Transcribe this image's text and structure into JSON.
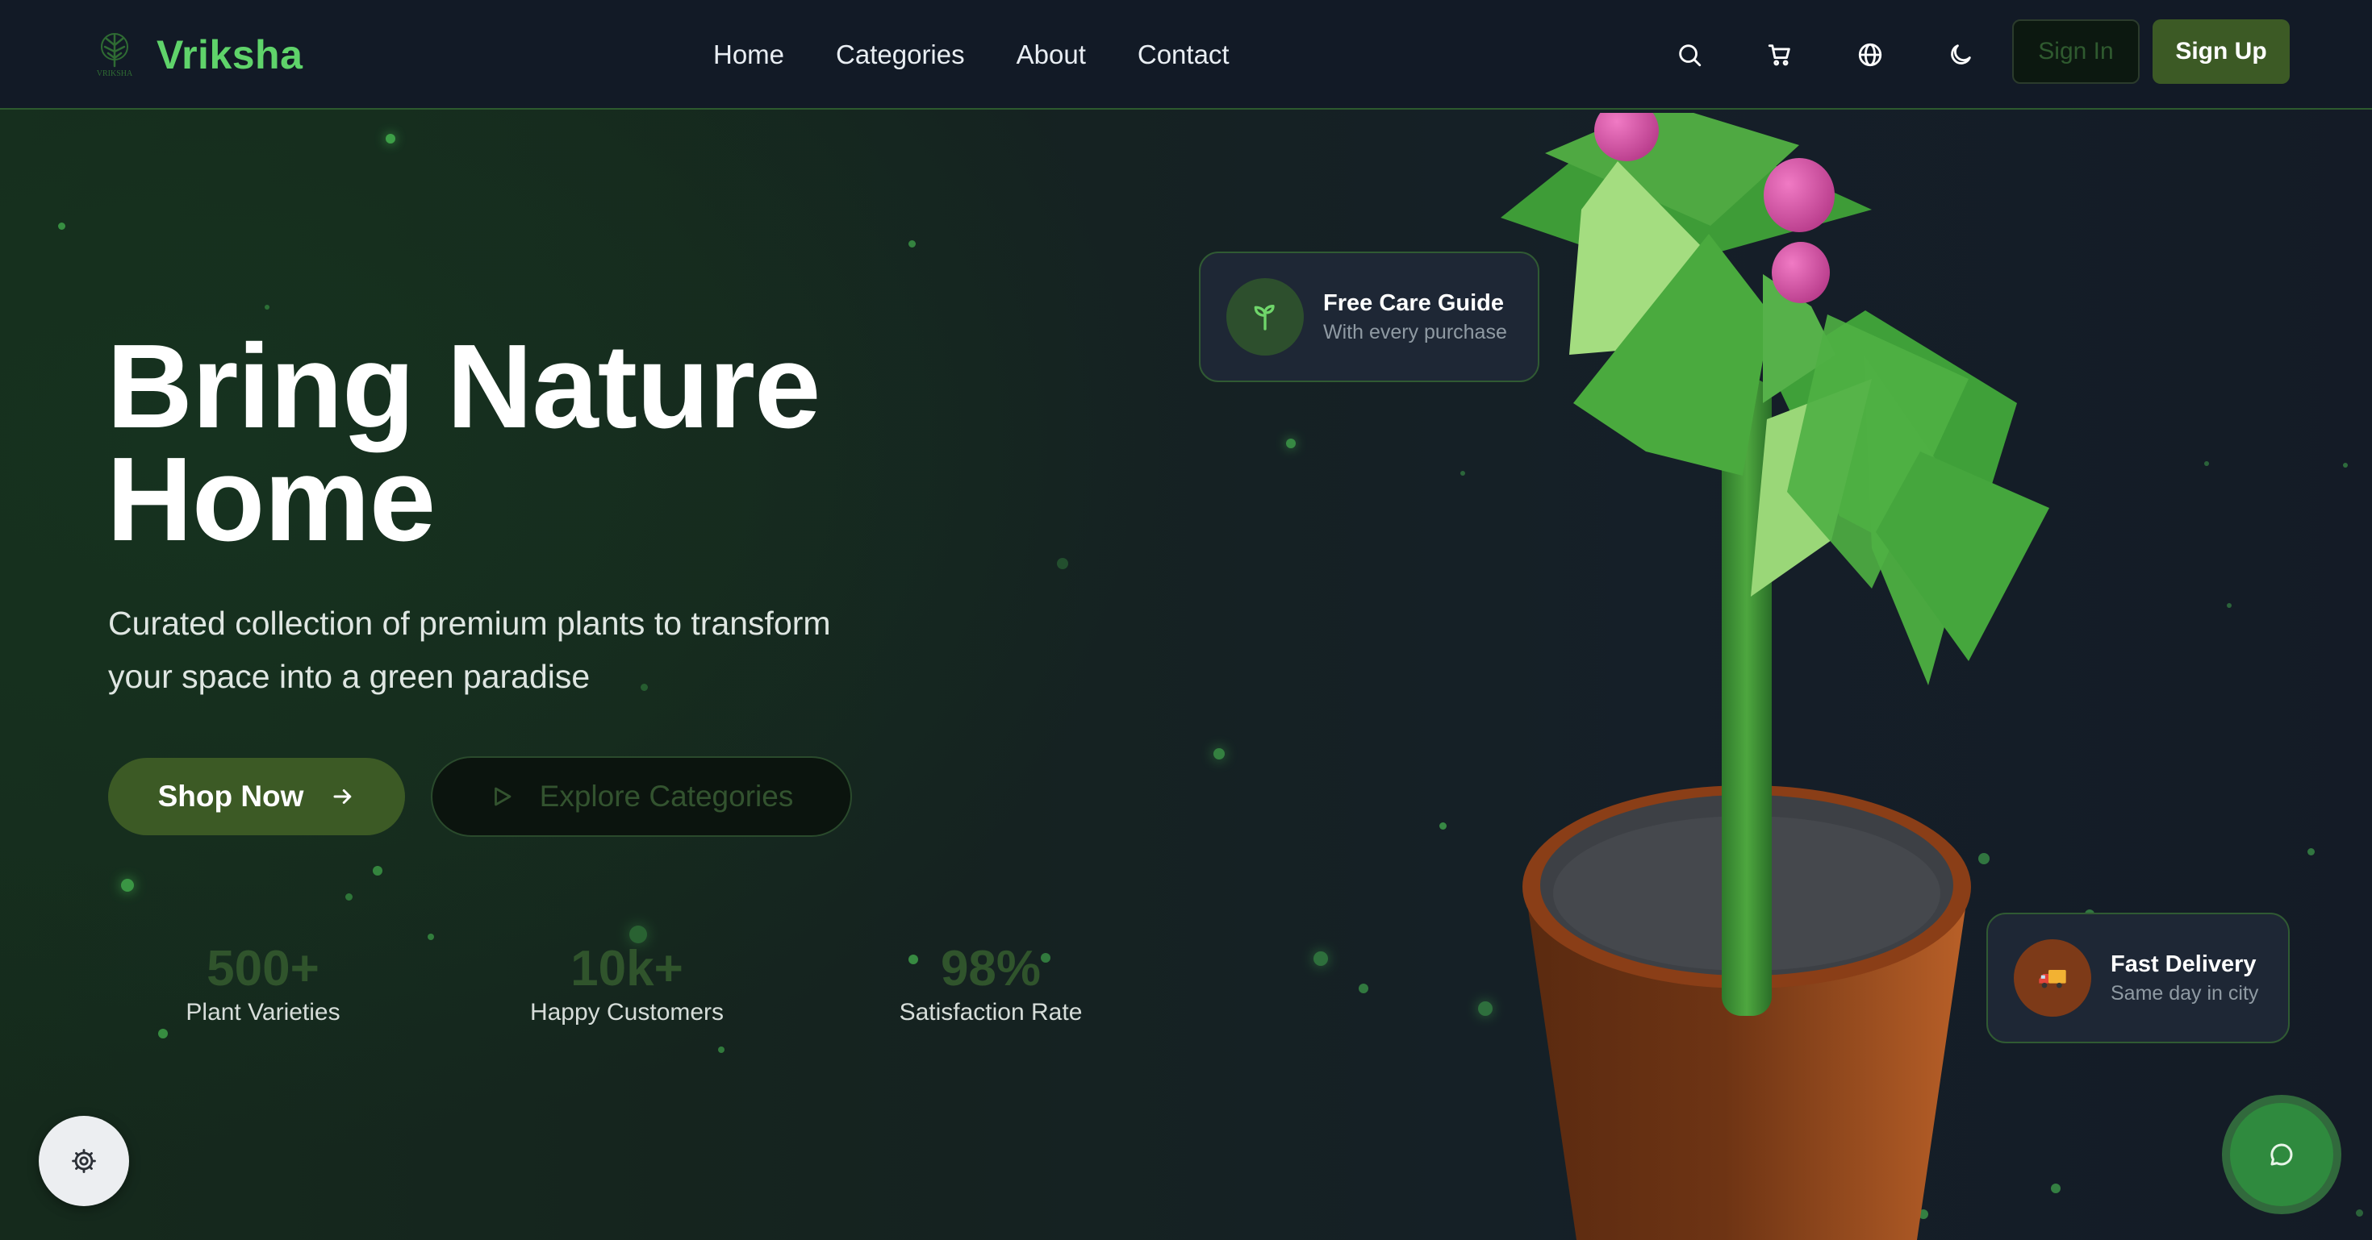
{
  "brand": {
    "name": "Vriksha",
    "logo_text": "VRIKSHA"
  },
  "nav": {
    "links": [
      "Home",
      "Categories",
      "About",
      "Contact"
    ],
    "tools": [
      "search-icon",
      "cart-icon",
      "globe-icon",
      "moon-icon"
    ],
    "sign_in": "Sign In",
    "sign_up": "Sign Up"
  },
  "hero": {
    "title_line1": "Bring Nature",
    "title_line2": "Home",
    "subtitle_line1": "Curated collection of premium plants to transform",
    "subtitle_line2": "your space into a green paradise",
    "shop_button": "Shop Now",
    "explore_button": "Explore Categories"
  },
  "stats": [
    {
      "value": "500+",
      "label": "Plant Varieties"
    },
    {
      "value": "10k+",
      "label": "Happy Customers"
    },
    {
      "value": "98%",
      "label": "Satisfaction Rate"
    }
  ],
  "cards": {
    "care": {
      "icon": "sprout-icon",
      "title": "Free Care Guide",
      "subtitle": "With every purchase"
    },
    "delivery": {
      "icon": "delivery-truck-icon",
      "title": "Fast Delivery",
      "subtitle": "Same day in city"
    }
  },
  "floating_actions": {
    "settings": "gear-icon",
    "chat": "chat-bubble-icon"
  },
  "colors": {
    "accent_green": "#5fd36a",
    "button_green": "#3c5a25",
    "navbar_bg": "#121a26",
    "pot": "#7d3a18",
    "berry": "#d856a8"
  }
}
